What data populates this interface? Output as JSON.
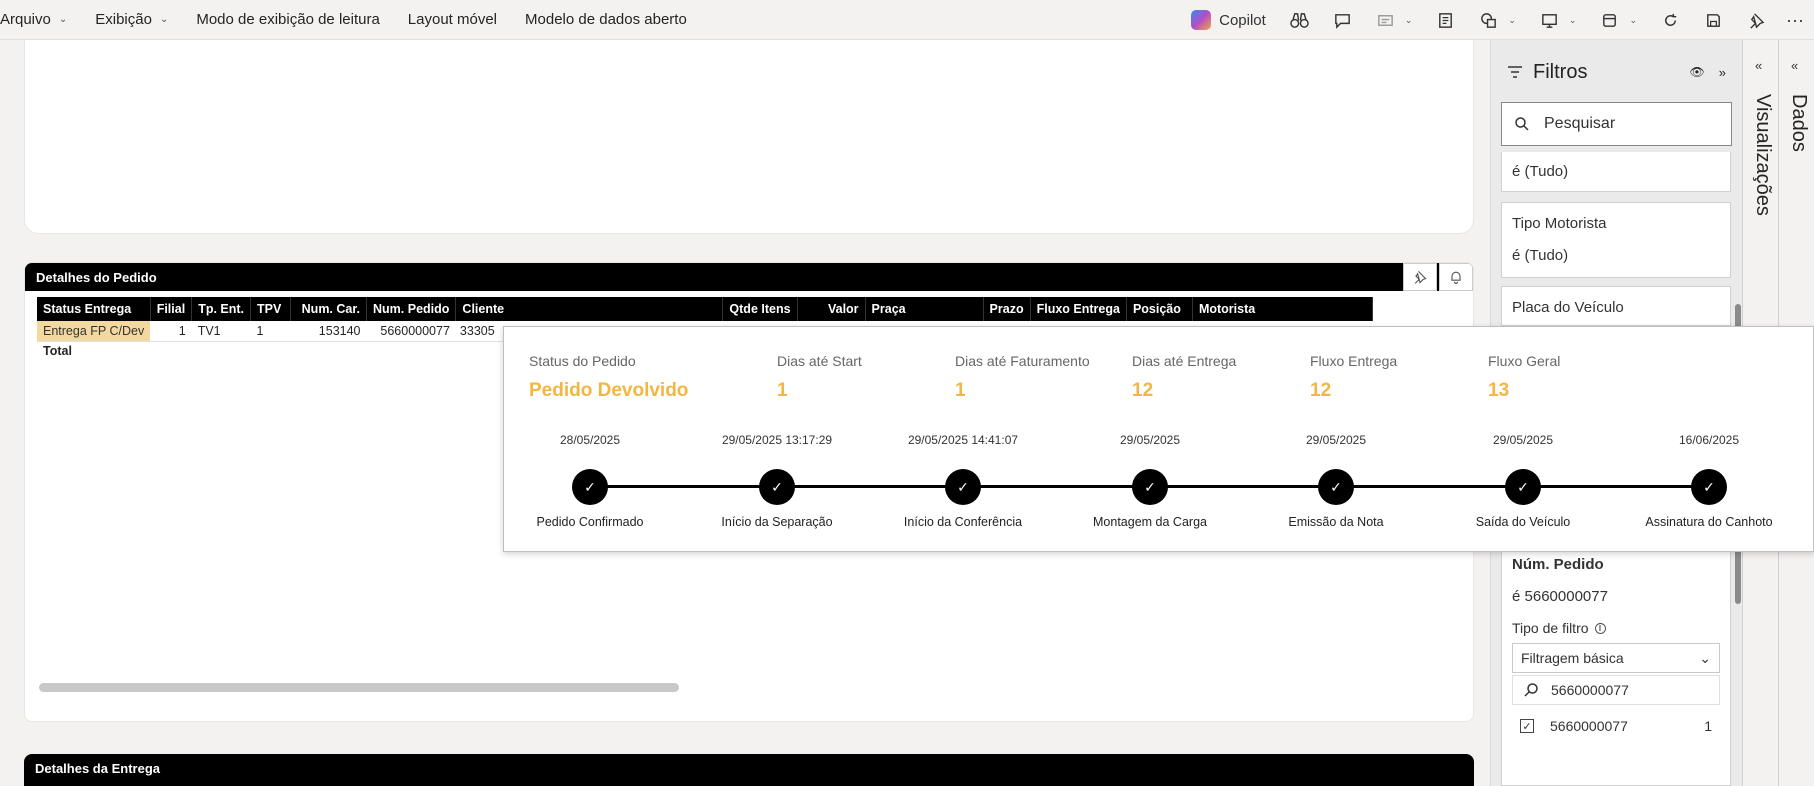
{
  "menu": {
    "items": [
      {
        "label": "Arquivo",
        "chevron": true
      },
      {
        "label": "Exibição",
        "chevron": true
      },
      {
        "label": "Modo de exibição de leitura",
        "chevron": false
      },
      {
        "label": "Layout móvel",
        "chevron": false
      },
      {
        "label": "Modelo de dados aberto",
        "chevron": false
      }
    ],
    "copilot_label": "Copilot"
  },
  "card_pedido": {
    "title": "Detalhes do Pedido",
    "columns": [
      "Status Entrega",
      "Filial",
      "Tp. Ent.",
      "TPV",
      "Num. Car.",
      "Num. Pedido",
      "Cliente",
      "Qtde Itens",
      "Valor",
      "Praça",
      "Prazo",
      "Fluxo Entrega",
      "Posição",
      "Motorista"
    ],
    "row": {
      "status": "Entrega FP C/Dev",
      "filial": "1",
      "tp_ent": "TV1",
      "tpv": "1",
      "num_car": "153140",
      "num_pedido": "5660000077",
      "cliente": "33305"
    },
    "total_label": "Total"
  },
  "card_entrega": {
    "title": "Detalhes da Entrega"
  },
  "tooltip": {
    "kpis": [
      {
        "label": "Status do Pedido",
        "value": "Pedido Devolvido"
      },
      {
        "label": "Dias até Start",
        "value": "1"
      },
      {
        "label": "Dias até Faturamento",
        "value": "1"
      },
      {
        "label": "Dias até Entrega",
        "value": "12"
      },
      {
        "label": "Fluxo Entrega",
        "value": "12"
      },
      {
        "label": "Fluxo Geral",
        "value": "13"
      }
    ],
    "steps": [
      {
        "date": "28/05/2025",
        "name": "Pedido Confirmado"
      },
      {
        "date": "29/05/2025 13:17:29",
        "name": "Início da Separação"
      },
      {
        "date": "29/05/2025 14:41:07",
        "name": "Início da Conferência"
      },
      {
        "date": "29/05/2025",
        "name": "Montagem da Carga"
      },
      {
        "date": "29/05/2025",
        "name": "Emissão da Nota"
      },
      {
        "date": "29/05/2025",
        "name": "Saída do Veículo"
      },
      {
        "date": "16/06/2025",
        "name": "Assinatura do Canhoto"
      }
    ],
    "check_glyph": "✓",
    "accent_color": "#f4b642"
  },
  "filters": {
    "title": "Filtros",
    "search_placeholder": "Pesquisar",
    "card1_value": "é (Tudo)",
    "card2_title": "Tipo Motorista",
    "card2_value": "é (Tudo)",
    "card3_title": "Placa do Veículo",
    "num_pedido": {
      "title": "Núm. Pedido",
      "value": "é 5660000077",
      "filter_type_label": "Tipo de filtro",
      "filter_type_value": "Filtragem básica",
      "search_value": "5660000077",
      "option_label": "5660000077",
      "option_count": "1"
    }
  },
  "side_panes": {
    "visualizacoes": "Visualizações",
    "dados": "Dados"
  }
}
